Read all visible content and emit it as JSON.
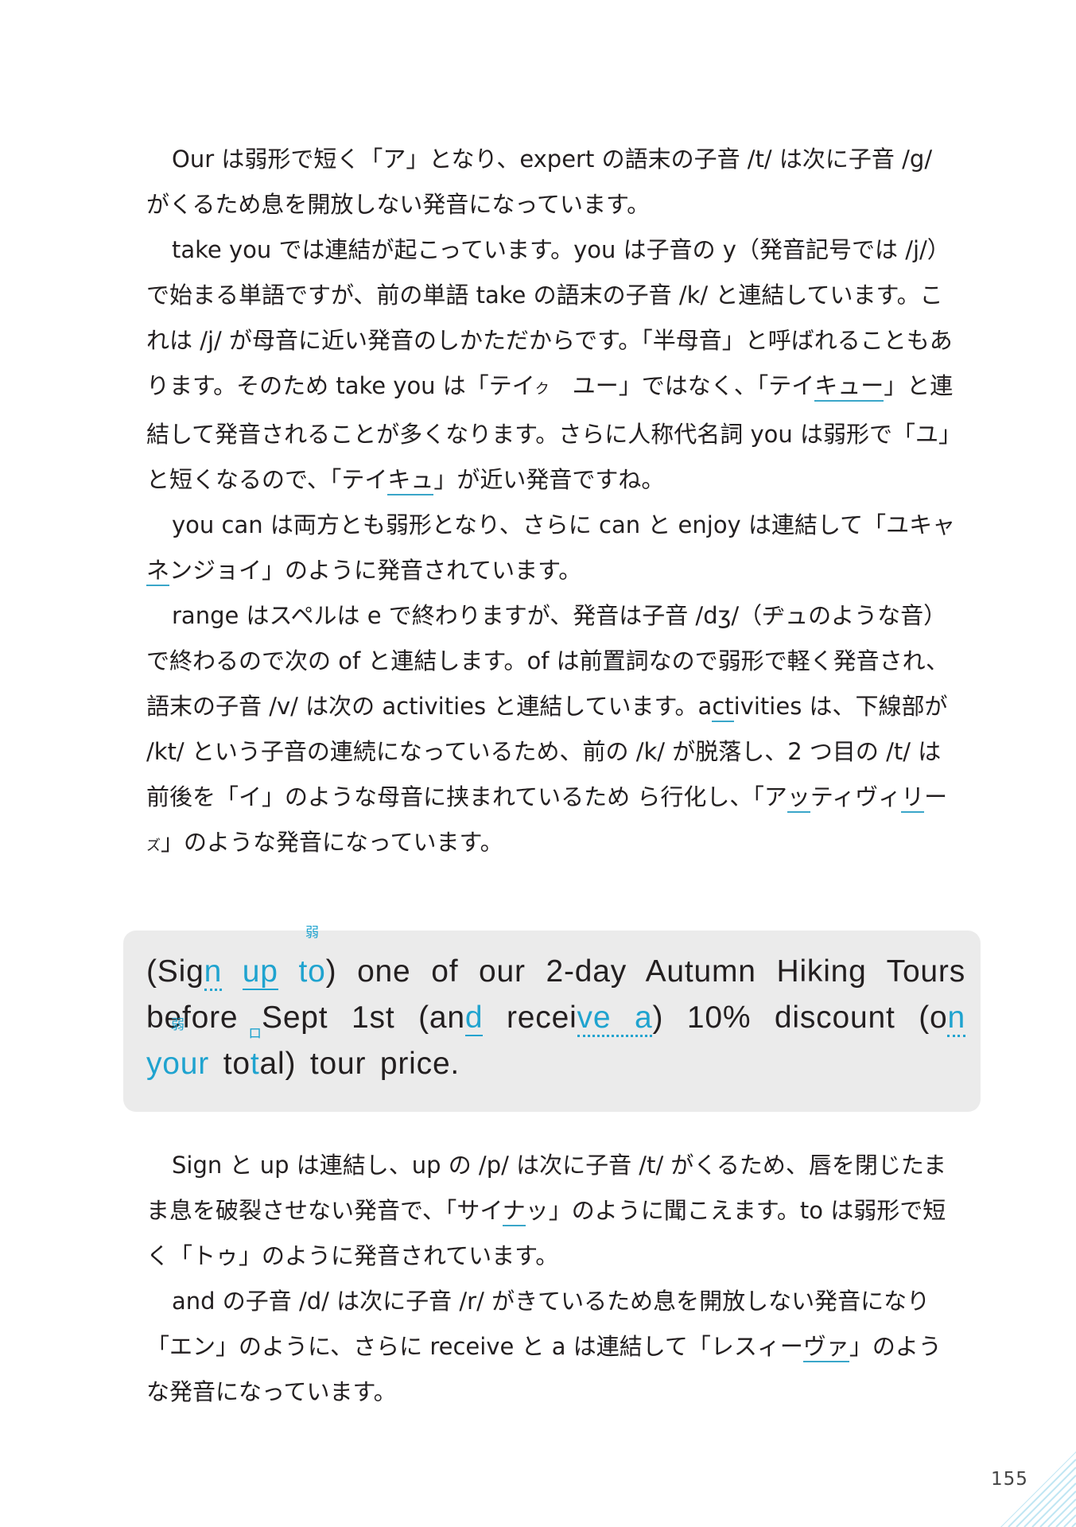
{
  "body_paragraphs_1": [
    {
      "runs": [
        {
          "t": "Our は弱形で短く「ア」となり、expert の語末の子音 /t/ は次に子音 /g/ がくるため息を開放しない発音になっています。"
        }
      ]
    },
    {
      "runs": [
        {
          "t": "take you では連結が起こっています。you は子音の y（発音記号では /j/）で始まる単語ですが、前の単語 take の語末の子音 /k/ と連結しています。これは /j/ が母音に近い発音のしかただからです。「半母音」と呼ばれることもあります。そのため take you は「テイ"
        },
        {
          "t": "ク",
          "s": true
        },
        {
          "t": "　ユー」ではなく、「テイ"
        },
        {
          "t": "キュー",
          "u": true
        },
        {
          "t": "」と連結して発音されることが多くなります。さらに人称代名詞 you は弱形で「ユ」と短くなるので、「テイ"
        },
        {
          "t": "キュ",
          "u": true
        },
        {
          "t": "」が近い発音ですね。"
        }
      ]
    },
    {
      "runs": [
        {
          "t": "you can は両方とも弱形となり、さらに can と enjoy は連結して「ユキャ"
        },
        {
          "t": "ネ",
          "u": true
        },
        {
          "t": "ンジョイ」のように発音されています。"
        }
      ]
    },
    {
      "runs": [
        {
          "t": "range はスペルは e で終わりますが、発音は子音 /dʒ/（ヂュのような音）で終わるので次の of と連結します。of は前置詞なので弱形で軽く発音され、語末の子音 /v/ は次の activities と連結しています。a"
        },
        {
          "t": "ct",
          "u": true
        },
        {
          "t": "ivities は、下線部が /kt/ という子音の連続になっているため、前の /k/ が脱落し、2 つ目の /t/ は前後を「イ」のような母音に挟まれているため ら行化し、「ア"
        },
        {
          "t": "ッ",
          "u": true
        },
        {
          "t": "ティヴィ"
        },
        {
          "t": "リ",
          "u": true
        },
        {
          "t": "ー"
        },
        {
          "t": "ズ",
          "s": true
        },
        {
          "t": "」のような発音になっています。"
        }
      ]
    }
  ],
  "example_sentence": {
    "marker_weak": "弱",
    "marker_flap": "ロ",
    "pieces": [
      "(Sig",
      "n",
      " ",
      "up",
      " ",
      "to",
      ") one of our 2-day Autumn Hiking Tours before Sept 1st (an",
      "d",
      " recei",
      "ve a",
      ") 10% discount (o",
      "n",
      " ",
      "your",
      " to",
      "t",
      "al) tour price."
    ]
  },
  "body_paragraphs_2": [
    {
      "runs": [
        {
          "t": "Sign と up は連結し、up の /p/ は次に子音 /t/ がくるため、唇を閉じたまま息を破裂させない発音で、「サイ"
        },
        {
          "t": "ナ",
          "u": true
        },
        {
          "t": "ッ」のように聞こえます。to は弱形で短く「トゥ」のように発音されています。"
        }
      ]
    },
    {
      "runs": [
        {
          "t": "and の子音 /d/ は次に子音 /r/ がきているため息を開放しない発音になり「エン」のように、さらに receive と a は連結して「レスィー"
        },
        {
          "t": "ヴァ",
          "u": true
        },
        {
          "t": "」のような発音になっています。"
        }
      ]
    }
  ],
  "page_number": "155",
  "colors": {
    "accent": "#1fa3cf",
    "box_bg": "#ebebeb",
    "text": "#231f20"
  }
}
